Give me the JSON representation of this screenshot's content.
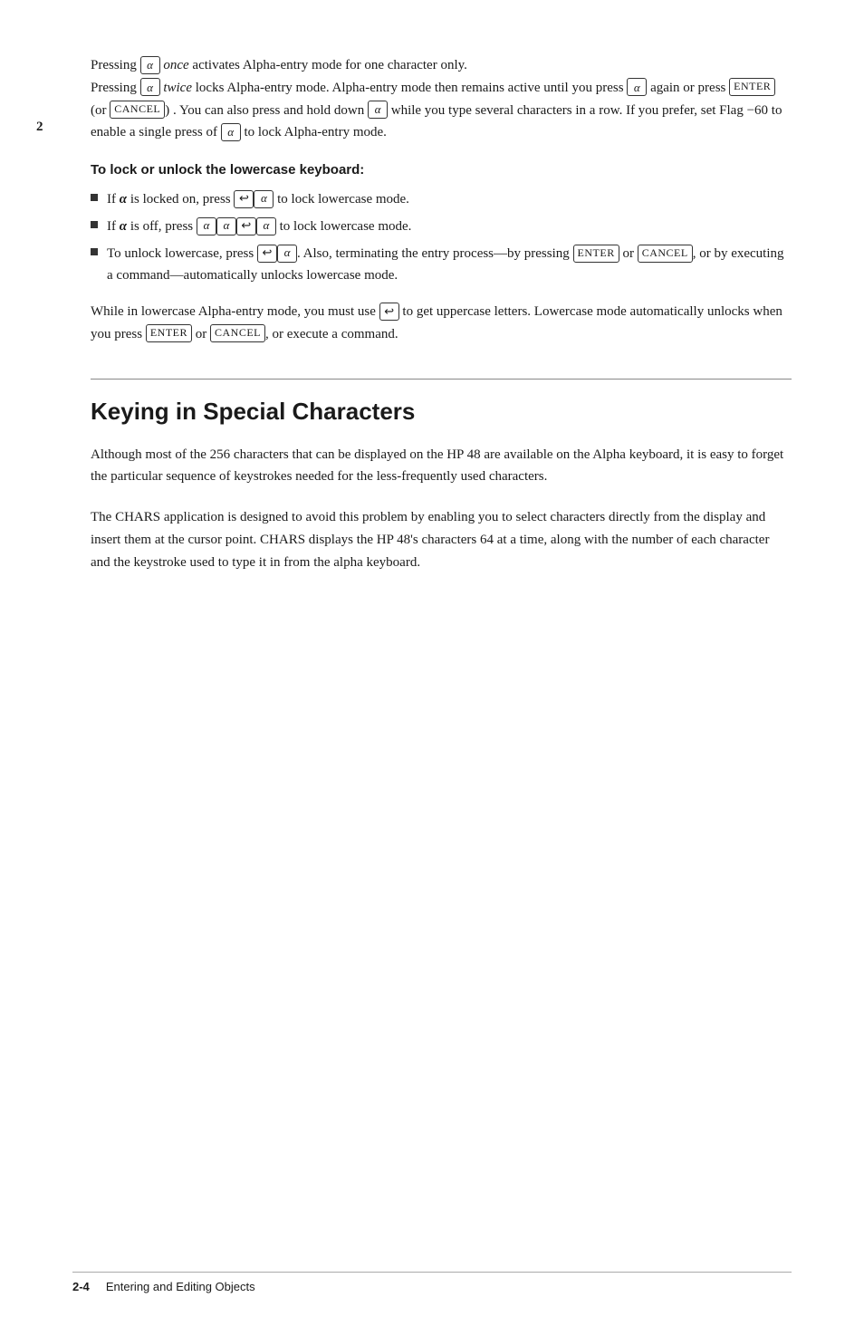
{
  "page": {
    "number": "2",
    "footer": {
      "label": "2-4",
      "text": "Entering and Editing Objects"
    }
  },
  "section1": {
    "para1": "Pressing",
    "para1_once": "once",
    "para1_rest": "activates Alpha-entry mode for one character only.",
    "para2": "Pressing",
    "para2_twice": "twice",
    "para2_rest": "locks Alpha-entry mode. Alpha-entry mode then remains active until you press",
    "para2_again": "again or press",
    "para2_or": "(or",
    "para2_end": "). You can also press and hold down",
    "para2_end2": "while you type several characters in a row. If you prefer, set Flag −60 to enable a single press of",
    "para2_end3": "to lock Alpha-entry mode.",
    "subheading": "To lock or unlock the lowercase keyboard:",
    "bullets": [
      {
        "text_before": "If",
        "alpha": "α",
        "text_middle": "is locked on, press",
        "text_end": "to lock lowercase mode."
      },
      {
        "text_before": "If",
        "alpha": "α",
        "text_middle": "is off, press",
        "text_end": "to lock lowercase mode."
      },
      {
        "text_before": "To unlock lowercase, press",
        "text_middle": ". Also, terminating the entry process—by pressing",
        "text_or": "or",
        "text_end": ", or by executing a command—automatically unlocks lowercase mode."
      }
    ],
    "para_lower1": "While in lowercase Alpha-entry mode, you must use",
    "para_lower1_end": "to get uppercase letters. Lowercase mode automatically unlocks when you press",
    "para_lower2_or": "or",
    "para_lower2_end": ", or execute a command."
  },
  "section2": {
    "title": "Keying in Special Characters",
    "para1": "Although most of the 256 characters that can be displayed on the HP 48 are available on the Alpha keyboard, it is easy to forget the particular sequence of keystrokes needed for the less-frequently used characters.",
    "para2": "The CHARS application is designed to avoid this problem by enabling you to select characters directly from the display and insert them at the cursor point. CHARS displays the HP 48's characters 64 at a time, along with the number of each character and the keystroke used to type it in from the alpha keyboard."
  }
}
